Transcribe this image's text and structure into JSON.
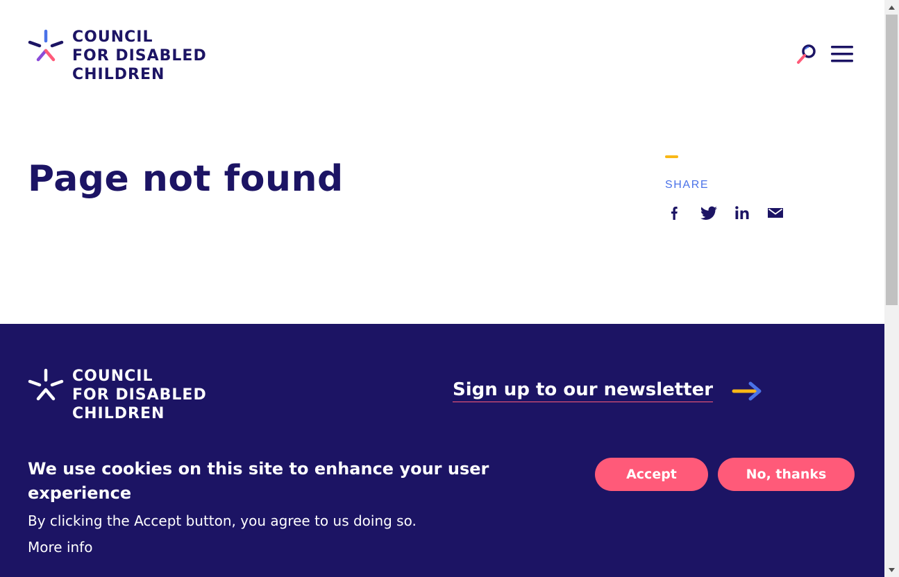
{
  "brand": {
    "name_lines": [
      "COUNCIL",
      "FOR DISABLED",
      "CHILDREN"
    ],
    "colors": {
      "navy": "#1c1464",
      "blue": "#4a72e8",
      "purple": "#8a4bd8",
      "pink": "#ff5a79",
      "yellow": "#f9b816"
    }
  },
  "header": {
    "search_icon": "search-icon",
    "menu_icon": "hamburger-menu-icon"
  },
  "main": {
    "title": "Page not found"
  },
  "share": {
    "label": "SHARE",
    "icons": [
      "facebook-icon",
      "twitter-icon",
      "linkedin-icon",
      "email-icon"
    ]
  },
  "footer": {
    "newsletter_label": "Sign up to our newsletter",
    "newsletter_icon": "arrow-right-icon"
  },
  "cookie_banner": {
    "title": "We use cookies on this site to enhance your user experience",
    "text": "By clicking the Accept button, you agree to us doing so.",
    "more_info": "More info",
    "accept_label": "Accept",
    "decline_label": "No, thanks"
  }
}
